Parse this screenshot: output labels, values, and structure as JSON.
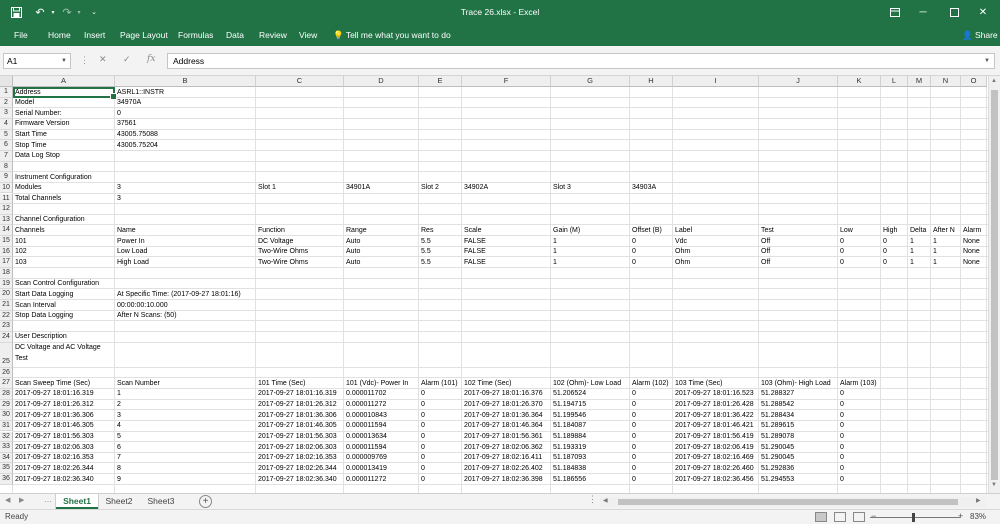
{
  "titlebar": {
    "document_title": "Trace 26.xlsx  -  Excel",
    "bg_color": "#217346",
    "quick_access": [
      "save-icon",
      "undo-icon",
      "redo-icon",
      "customize-icon"
    ]
  },
  "ribbon": {
    "tabs": [
      "File",
      "Home",
      "Insert",
      "Page Layout",
      "Formulas",
      "Data",
      "Review",
      "View"
    ],
    "tell_me": "Tell me what you want to do",
    "share": "Share"
  },
  "formula_bar": {
    "name_box": "A1",
    "fx": "fx",
    "value": "Address"
  },
  "columns": [
    "A",
    "B",
    "C",
    "D",
    "E",
    "F",
    "G",
    "H",
    "I",
    "J",
    "K",
    "L",
    "M",
    "N",
    "O"
  ],
  "rows": [
    {
      "n": "1",
      "cells": {
        "A": "Address",
        "B": "ASRL1::INSTR"
      }
    },
    {
      "n": "2",
      "cells": {
        "A": "Model",
        "B": "34970A"
      }
    },
    {
      "n": "3",
      "cells": {
        "A": "Serial Number:",
        "B": "0"
      }
    },
    {
      "n": "4",
      "cells": {
        "A": "Firmware Version",
        "B": "37561"
      }
    },
    {
      "n": "5",
      "cells": {
        "A": "Start Time",
        "B": "43005.75088"
      }
    },
    {
      "n": "6",
      "cells": {
        "A": "Stop Time",
        "B": "43005.75204"
      }
    },
    {
      "n": "7",
      "cells": {
        "A": "Data Log Stop"
      }
    },
    {
      "n": "8",
      "cells": {}
    },
    {
      "n": "9",
      "cells": {
        "A": "Instrument Configuration"
      }
    },
    {
      "n": "10",
      "cells": {
        "A": "Modules",
        "B": "3",
        "C": "Slot 1",
        "D": "34901A",
        "E": "Slot 2",
        "F": "34902A",
        "G": "Slot 3",
        "H": "34903A"
      }
    },
    {
      "n": "11",
      "cells": {
        "A": "Total Channels",
        "B": "3"
      }
    },
    {
      "n": "12",
      "cells": {}
    },
    {
      "n": "13",
      "cells": {
        "A": "Channel Configuration"
      }
    },
    {
      "n": "14",
      "cells": {
        "A": "Channels",
        "B": "Name",
        "C": "Function",
        "D": "Range",
        "E": "Res",
        "F": "Scale",
        "G": "Gain (M)",
        "H": "Offset (B)",
        "I": "Label",
        "J": "Test",
        "K": "Low",
        "L": "High",
        "M": "Delta",
        "N": "After N",
        "O": "Alarm"
      }
    },
    {
      "n": "15",
      "cells": {
        "A": "101",
        "B": "Power In",
        "C": "DC Voltage",
        "D": "Auto",
        "E": "5.5",
        "F": "FALSE",
        "G": "1",
        "H": "0",
        "I": "Vdc",
        "J": "Off",
        "K": "0",
        "L": "0",
        "M": "1",
        "N": "1",
        "O": "None"
      }
    },
    {
      "n": "16",
      "cells": {
        "A": "102",
        "B": "Low Load",
        "C": "Two-Wire Ohms",
        "D": "Auto",
        "E": "5.5",
        "F": "FALSE",
        "G": "1",
        "H": "0",
        "I": "Ohm",
        "J": "Off",
        "K": "0",
        "L": "0",
        "M": "1",
        "N": "1",
        "O": "None"
      }
    },
    {
      "n": "17",
      "cells": {
        "A": "103",
        "B": "High Load",
        "C": "Two-Wire Ohms",
        "D": "Auto",
        "E": "5.5",
        "F": "FALSE",
        "G": "1",
        "H": "0",
        "I": "Ohm",
        "J": "Off",
        "K": "0",
        "L": "0",
        "M": "1",
        "N": "1",
        "O": "None"
      }
    },
    {
      "n": "18",
      "cells": {}
    },
    {
      "n": "19",
      "cells": {
        "A": "Scan Control Configuration"
      }
    },
    {
      "n": "20",
      "cells": {
        "A": "Start Data Logging",
        "B": "At Specific Time: (2017-09-27 18:01:16)"
      }
    },
    {
      "n": "21",
      "cells": {
        "A": "Scan Interval",
        "B": "00:00:00:10.000"
      }
    },
    {
      "n": "22",
      "cells": {
        "A": "Stop Data Logging",
        "B": "After N Scans: (50)"
      }
    },
    {
      "n": "23",
      "cells": {}
    },
    {
      "n": "24",
      "cells": {
        "A": "User Description"
      }
    },
    {
      "n": "25",
      "cells": {
        "A": "DC Voltage and AC Voltage Test"
      }
    },
    {
      "n": "26",
      "cells": {}
    },
    {
      "n": "27",
      "cells": {
        "A": "Scan Sweep Time (Sec)",
        "B": "Scan Number",
        "C": "101 Time (Sec)",
        "D": "101 (Vdc)- Power In",
        "E": "Alarm (101)",
        "F": "102 Time (Sec)",
        "G": "102 (Ohm)- Low Load",
        "H": "Alarm (102)",
        "I": "103 Time (Sec)",
        "J": "103 (Ohm)- High Load",
        "K": "Alarm (103)"
      }
    },
    {
      "n": "28",
      "cells": {
        "A": "2017-09-27 18:01:16.319",
        "B": "1",
        "C": "2017-09-27 18:01:16.319",
        "D": "0.000011702",
        "E": "0",
        "F": "2017-09-27 18:01:16.376",
        "G": "51.206524",
        "H": "0",
        "I": "2017-09-27 18:01:16.523",
        "J": "51.288327",
        "K": "0"
      }
    },
    {
      "n": "29",
      "cells": {
        "A": "2017-09-27 18:01:26.312",
        "B": "2",
        "C": "2017-09-27 18:01:26.312",
        "D": "0.000011272",
        "E": "0",
        "F": "2017-09-27 18:01:26.370",
        "G": "51.194715",
        "H": "0",
        "I": "2017-09-27 18:01:26.428",
        "J": "51.288542",
        "K": "0"
      }
    },
    {
      "n": "30",
      "cells": {
        "A": "2017-09-27 18:01:36.306",
        "B": "3",
        "C": "2017-09-27 18:01:36.306",
        "D": "0.000010843",
        "E": "0",
        "F": "2017-09-27 18:01:36.364",
        "G": "51.199546",
        "H": "0",
        "I": "2017-09-27 18:01:36.422",
        "J": "51.288434",
        "K": "0"
      }
    },
    {
      "n": "31",
      "cells": {
        "A": "2017-09-27 18:01:46.305",
        "B": "4",
        "C": "2017-09-27 18:01:46.305",
        "D": "0.000011594",
        "E": "0",
        "F": "2017-09-27 18:01:46.364",
        "G": "51.184087",
        "H": "0",
        "I": "2017-09-27 18:01:46.421",
        "J": "51.289615",
        "K": "0"
      }
    },
    {
      "n": "32",
      "cells": {
        "A": "2017-09-27 18:01:56.303",
        "B": "5",
        "C": "2017-09-27 18:01:56.303",
        "D": "0.000013634",
        "E": "0",
        "F": "2017-09-27 18:01:56.361",
        "G": "51.189884",
        "H": "0",
        "I": "2017-09-27 18:01:56.419",
        "J": "51.289078",
        "K": "0"
      }
    },
    {
      "n": "33",
      "cells": {
        "A": "2017-09-27 18:02:06.303",
        "B": "6",
        "C": "2017-09-27 18:02:06.303",
        "D": "0.000011594",
        "E": "0",
        "F": "2017-09-27 18:02:06.362",
        "G": "51.193319",
        "H": "0",
        "I": "2017-09-27 18:02:06.419",
        "J": "51.290045",
        "K": "0"
      }
    },
    {
      "n": "34",
      "cells": {
        "A": "2017-09-27 18:02:16.353",
        "B": "7",
        "C": "2017-09-27 18:02:16.353",
        "D": "0.000009769",
        "E": "0",
        "F": "2017-09-27 18:02:16.411",
        "G": "51.187093",
        "H": "0",
        "I": "2017-09-27 18:02:16.469",
        "J": "51.290045",
        "K": "0"
      }
    },
    {
      "n": "35",
      "cells": {
        "A": "2017-09-27 18:02:26.344",
        "B": "8",
        "C": "2017-09-27 18:02:26.344",
        "D": "0.000013419",
        "E": "0",
        "F": "2017-09-27 18:02:26.402",
        "G": "51.184838",
        "H": "0",
        "I": "2017-09-27 18:02:26.460",
        "J": "51.292836",
        "K": "0"
      }
    },
    {
      "n": "36",
      "cells": {
        "A": "2017-09-27 18:02:36.340",
        "B": "9",
        "C": "2017-09-27 18:02:36.340",
        "D": "0.000011272",
        "E": "0",
        "F": "2017-09-27 18:02:36.398",
        "G": "51.186556",
        "H": "0",
        "I": "2017-09-27 18:02:36.456",
        "J": "51.294553",
        "K": "0"
      }
    }
  ],
  "sheets": [
    "Sheet1",
    "Sheet2",
    "Sheet3"
  ],
  "active_sheet": "Sheet1",
  "status": {
    "ready": "Ready",
    "zoom": "83%"
  }
}
